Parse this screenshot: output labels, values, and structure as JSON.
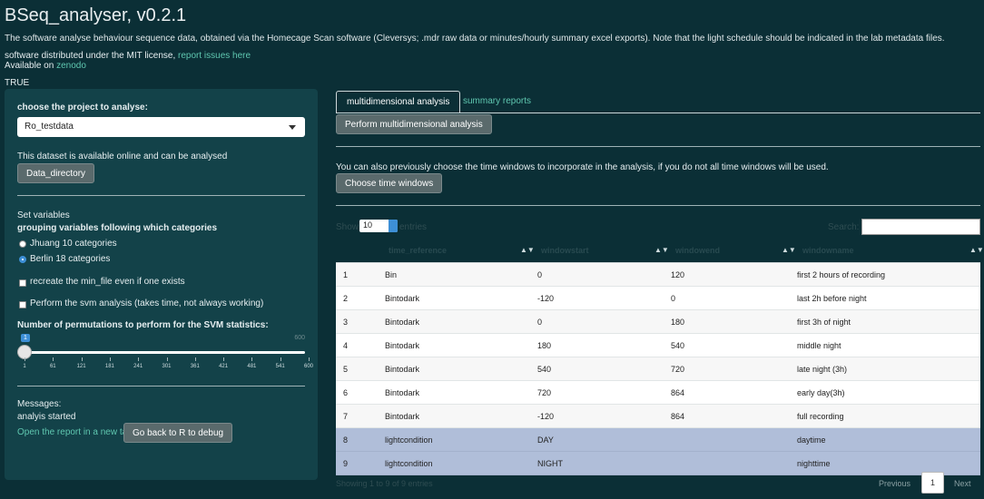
{
  "header": {
    "title": "BSeq_analyser, v0.2.1",
    "description": "The software analyse behaviour sequence data, obtained via the Homecage Scan software (Cleversys; .mdr raw data or minutes/hourly summary excel exports). Note that the light schedule should be indicated in the lab metadata files.",
    "license_text": "software distributed under the MIT license,",
    "report_issues_link": "report issues here",
    "available_on": "Available on",
    "zenodo_link": "zenodo",
    "true_text": "TRUE"
  },
  "sidebar": {
    "project_label": "choose the project to analyse:",
    "project_value": "Ro_testdata",
    "dataset_info": "This dataset is available online and can be analysed",
    "data_directory_button": "Data_directory",
    "set_variables": "Set variables",
    "grouping_label": "grouping variables following which categories",
    "radio_options": [
      {
        "label": "Jhuang 10 categories",
        "selected": false
      },
      {
        "label": "Berlin 18 categories",
        "selected": true
      }
    ],
    "recreate_checkbox": "recreate the min_file even if one exists",
    "svm_checkbox": "Perform the svm analysis (takes time, not always working)",
    "permutations_label": "Number of permutations to perform for the SVM statistics:",
    "slider": {
      "value": "1",
      "max_label": "600",
      "ticks": [
        "1",
        "61",
        "121",
        "181",
        "241",
        "301",
        "361",
        "421",
        "481",
        "541",
        "600"
      ]
    },
    "messages_label": "Messages:",
    "messages_text": "analyis started",
    "open_report_link": "Open the report in a new tab",
    "debug_button": "Go back to R to debug"
  },
  "main": {
    "tabs": [
      {
        "label": "multidimensional analysis",
        "active": true
      },
      {
        "label": "summary reports",
        "active": false
      }
    ],
    "perform_button": "Perform multidimensional analysis",
    "time_window_note": "You can also previously choose the time windows to incorporate in the analysis, if you do not all time windows will be used.",
    "choose_time_windows_button": "Choose time windows",
    "table_controls": {
      "show_label": "Show",
      "length_value": "10",
      "entries_label": "entries",
      "search_label": "Search:"
    },
    "table": {
      "columns": [
        "",
        "time_reference",
        "windowstart",
        "windowend",
        "windowname"
      ],
      "rows": [
        {
          "idx": "1",
          "time_reference": "Bin",
          "windowstart": "0",
          "windowend": "120",
          "windowname": "first 2 hours of recording",
          "selected": false
        },
        {
          "idx": "2",
          "time_reference": "Bintodark",
          "windowstart": "-120",
          "windowend": "0",
          "windowname": "last 2h before night",
          "selected": false
        },
        {
          "idx": "3",
          "time_reference": "Bintodark",
          "windowstart": "0",
          "windowend": "180",
          "windowname": "first 3h of night",
          "selected": false
        },
        {
          "idx": "4",
          "time_reference": "Bintodark",
          "windowstart": "180",
          "windowend": "540",
          "windowname": "middle night",
          "selected": false
        },
        {
          "idx": "5",
          "time_reference": "Bintodark",
          "windowstart": "540",
          "windowend": "720",
          "windowname": "late night (3h)",
          "selected": false
        },
        {
          "idx": "6",
          "time_reference": "Bintodark",
          "windowstart": "720",
          "windowend": "864",
          "windowname": "early day(3h)",
          "selected": false
        },
        {
          "idx": "7",
          "time_reference": "Bintodark",
          "windowstart": "-120",
          "windowend": "864",
          "windowname": "full recording",
          "selected": false
        },
        {
          "idx": "8",
          "time_reference": "lightcondition",
          "windowstart": "DAY",
          "windowend": "",
          "windowname": "daytime",
          "selected": true
        },
        {
          "idx": "9",
          "time_reference": "lightcondition",
          "windowstart": "NIGHT",
          "windowend": "",
          "windowname": "nighttime",
          "selected": true
        }
      ]
    },
    "pagination": {
      "info": "Showing 1 to 9 of 9 entries",
      "previous": "Previous",
      "current_page": "1",
      "next": "Next"
    }
  },
  "colors": {
    "background": "#0b2f36",
    "sidebar": "#134249",
    "link": "#5fc7b0",
    "selected_row": "#b0bed9",
    "slider_accent": "#3d8fd6"
  }
}
